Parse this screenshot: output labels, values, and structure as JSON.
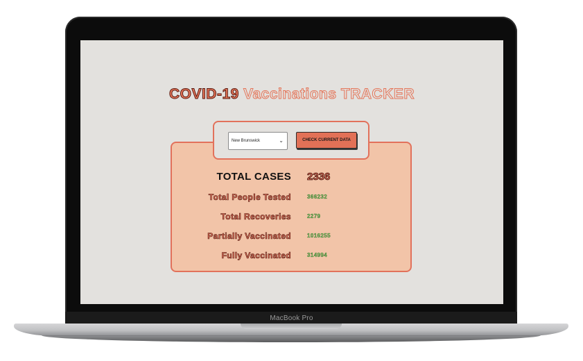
{
  "device": {
    "brand_label": "MacBook Pro"
  },
  "app": {
    "title_part1": "COVID-19",
    "title_part2": "Vaccinations TRACKER",
    "colors": {
      "accent": "#e2715b",
      "card_background": "#f2c4a8",
      "page_background": "#e3e1de",
      "value_green": "#6fbf5a"
    }
  },
  "controls": {
    "province_select": {
      "selected": "New Brunswick"
    },
    "check_button_label": "CHECK CURRENT DATA"
  },
  "stats": {
    "total_cases": {
      "label": "TOTAL CASES",
      "value": "2336"
    },
    "rows": [
      {
        "label": "Total People Tested",
        "value": "366232"
      },
      {
        "label": "Total Recoveries",
        "value": "2279"
      },
      {
        "label": "Partially Vaccinated",
        "value": "1016255"
      },
      {
        "label": "Fully Vaccinated",
        "value": "314994"
      }
    ]
  }
}
